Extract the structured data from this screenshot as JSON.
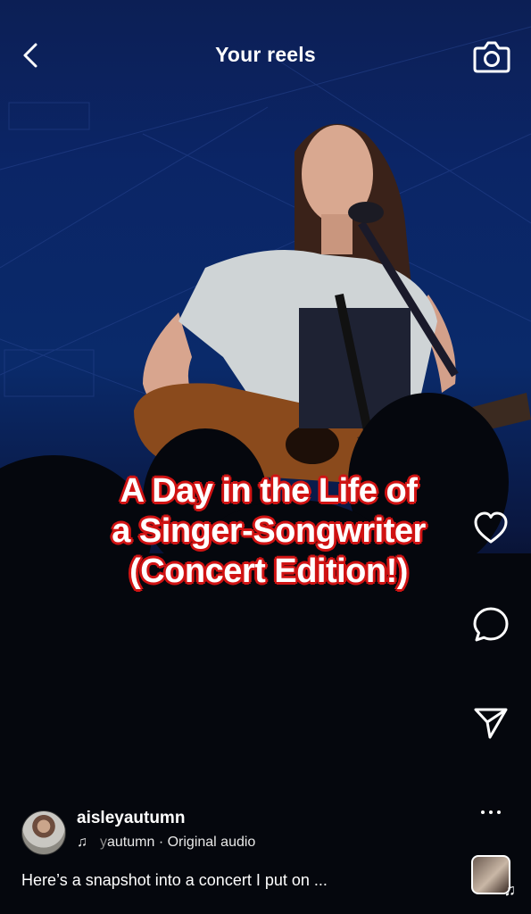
{
  "header": {
    "title": "Your reels"
  },
  "icons": {
    "back": "chevron-left-icon",
    "camera": "camera-icon",
    "like": "heart-icon",
    "comment": "comment-icon",
    "share": "send-icon",
    "more": "more-horizontal-icon",
    "audio": "music-note-icon"
  },
  "overlay_caption": [
    "A Day in the Life of",
    "a Singer-Songwriter",
    "(Concert Edition!)"
  ],
  "reel": {
    "username": "aisleyautumn",
    "audio_prefix": "y",
    "audio_label": "autumn · Original audio",
    "description": "Here’s a snapshot into a concert I put on ..."
  },
  "colors": {
    "caption_outline": "#d01515",
    "background": "#0a2a6a"
  }
}
